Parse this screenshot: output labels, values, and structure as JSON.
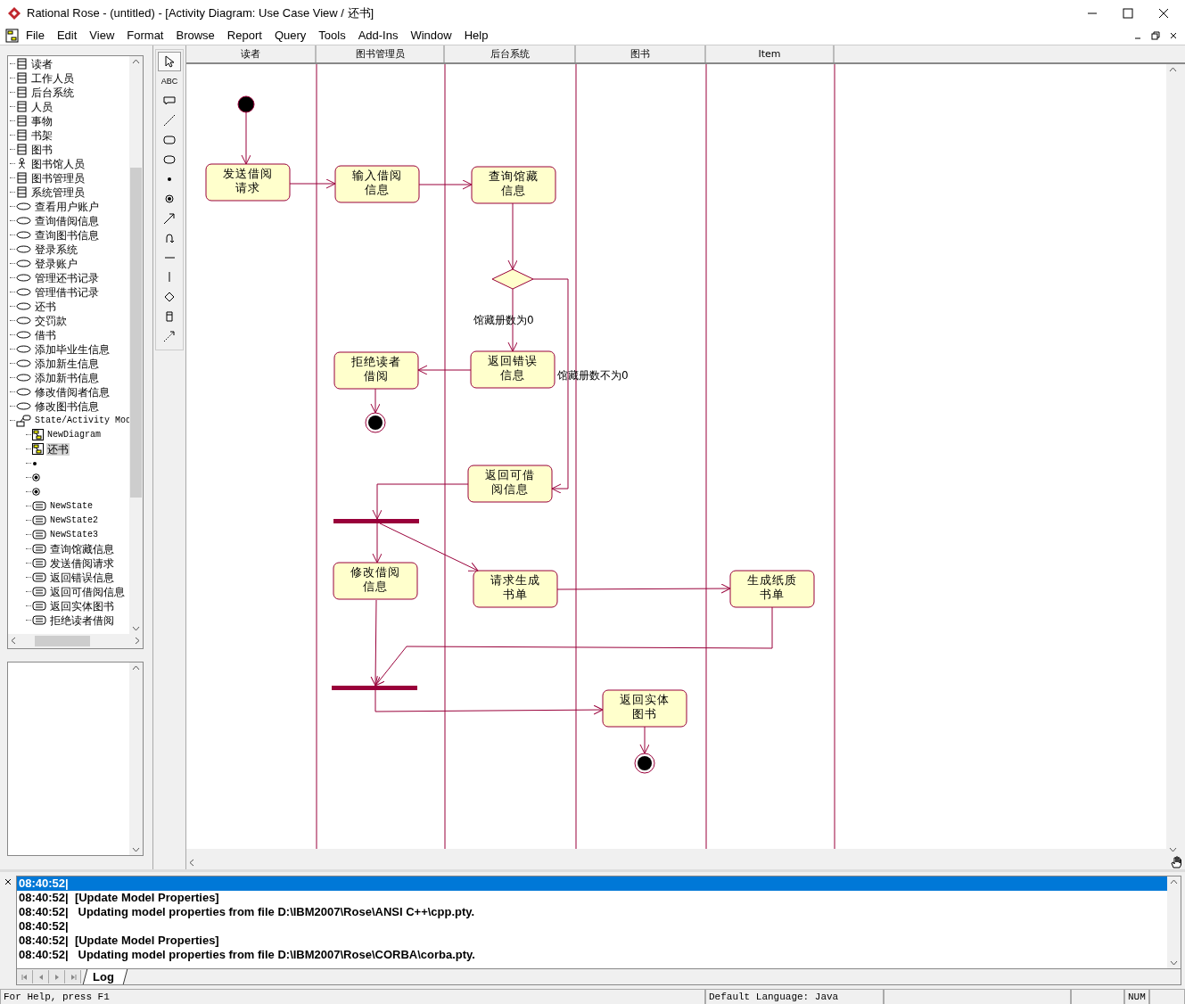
{
  "window": {
    "title": "Rational Rose - (untitled) - [Activity Diagram: Use Case View / 还书]"
  },
  "menu": [
    "File",
    "Edit",
    "View",
    "Format",
    "Browse",
    "Report",
    "Query",
    "Tools",
    "Add-Ins",
    "Window",
    "Help"
  ],
  "browser": {
    "items": [
      {
        "label": "读者",
        "kind": "class",
        "selected": false
      },
      {
        "label": "工作人员",
        "kind": "class",
        "selected": false
      },
      {
        "label": "后台系统",
        "kind": "class",
        "selected": false
      },
      {
        "label": "人员",
        "kind": "class",
        "selected": false
      },
      {
        "label": "事物",
        "kind": "class",
        "selected": false
      },
      {
        "label": "书架",
        "kind": "class",
        "selected": false
      },
      {
        "label": "图书",
        "kind": "class",
        "selected": false
      },
      {
        "label": "图书馆人员",
        "kind": "actor",
        "selected": false
      },
      {
        "label": "图书管理员",
        "kind": "class",
        "selected": false
      },
      {
        "label": "系统管理员",
        "kind": "class",
        "selected": false
      },
      {
        "label": "查看用户账户",
        "kind": "usecase",
        "selected": false
      },
      {
        "label": "查询借阅信息",
        "kind": "usecase",
        "selected": false
      },
      {
        "label": "查询图书信息",
        "kind": "usecase",
        "selected": false
      },
      {
        "label": "登录系统",
        "kind": "usecase",
        "selected": false
      },
      {
        "label": "登录账户",
        "kind": "usecase",
        "selected": false
      },
      {
        "label": "管理还书记录",
        "kind": "usecase",
        "selected": false
      },
      {
        "label": "管理借书记录",
        "kind": "usecase",
        "selected": false
      },
      {
        "label": "还书",
        "kind": "usecase",
        "selected": false
      },
      {
        "label": "交罚款",
        "kind": "usecase",
        "selected": false
      },
      {
        "label": "借书",
        "kind": "usecase",
        "selected": false
      },
      {
        "label": "添加毕业生信息",
        "kind": "usecase",
        "selected": false
      },
      {
        "label": "添加新生信息",
        "kind": "usecase",
        "selected": false
      },
      {
        "label": "添加新书信息",
        "kind": "usecase",
        "selected": false
      },
      {
        "label": "修改借阅者信息",
        "kind": "usecase",
        "selected": false
      },
      {
        "label": "修改图书信息",
        "kind": "usecase",
        "selected": false
      },
      {
        "label": "State/Activity Mod",
        "kind": "package",
        "selected": false,
        "children": [
          {
            "label": "NewDiagram",
            "kind": "diagram",
            "selected": false
          },
          {
            "label": "还书",
            "kind": "diagram",
            "selected": true
          },
          {
            "kind": "start",
            "selected": false
          },
          {
            "kind": "end",
            "selected": false
          },
          {
            "kind": "end",
            "selected": false
          },
          {
            "label": "NewState",
            "kind": "state",
            "selected": false
          },
          {
            "label": "NewState2",
            "kind": "state",
            "selected": false
          },
          {
            "label": "NewState3",
            "kind": "state",
            "selected": false
          },
          {
            "label": "查询馆藏信息",
            "kind": "state",
            "selected": false
          },
          {
            "label": "发送借阅请求",
            "kind": "state",
            "selected": false
          },
          {
            "label": "返回错误信息",
            "kind": "state",
            "selected": false
          },
          {
            "label": "返回可借阅信息",
            "kind": "state",
            "selected": false
          },
          {
            "label": "返回实体图书",
            "kind": "state",
            "selected": false
          },
          {
            "label": "拒绝读者借阅",
            "kind": "state",
            "selected": false
          }
        ]
      }
    ]
  },
  "toolbox": [
    {
      "kind": "pointer",
      "selected": true
    },
    {
      "kind": "text",
      "label": "ABC",
      "selected": false
    },
    {
      "kind": "note",
      "selected": false
    },
    {
      "kind": "anchor",
      "selected": false
    },
    {
      "kind": "state",
      "selected": false
    },
    {
      "kind": "activity",
      "selected": false
    },
    {
      "kind": "start",
      "selected": false
    },
    {
      "kind": "end",
      "selected": false
    },
    {
      "kind": "transition",
      "selected": false
    },
    {
      "kind": "loop",
      "selected": false
    },
    {
      "kind": "hsync",
      "selected": false
    },
    {
      "kind": "vsync",
      "selected": false
    },
    {
      "kind": "decision",
      "selected": false
    },
    {
      "kind": "swimlane",
      "selected": false
    },
    {
      "kind": "flow",
      "selected": false
    }
  ],
  "diagram": {
    "swimlanes": [
      "读者",
      "图书管理员",
      "后台系统",
      "图书",
      "Item"
    ],
    "activities": [
      {
        "lines": [
          "发送借阅",
          "请求"
        ]
      },
      {
        "lines": [
          "输入借阅",
          "信息"
        ]
      },
      {
        "lines": [
          "查询馆藏",
          "信息"
        ]
      },
      {
        "lines": [
          "拒绝读者",
          "借阅"
        ]
      },
      {
        "lines": [
          "返回错误",
          "信息"
        ]
      },
      {
        "lines": [
          "返回可借",
          "阅信息"
        ]
      },
      {
        "lines": [
          "修改借阅",
          "信息"
        ]
      },
      {
        "lines": [
          "请求生成",
          "书单"
        ]
      },
      {
        "lines": [
          "生成纸质",
          "书单"
        ]
      },
      {
        "lines": [
          "返回实体",
          "图书"
        ]
      }
    ],
    "guards": [
      "馆藏册数为0",
      "馆藏册数不为0"
    ]
  },
  "log": {
    "lines": [
      {
        "text": "08:40:52|",
        "selected": true
      },
      {
        "text": "08:40:52|  [Update Model Properties]",
        "selected": false
      },
      {
        "text": "08:40:52|   Updating model properties from file D:\\IBM2007\\Rose\\ANSI C++\\cpp.pty.",
        "selected": false
      },
      {
        "text": "08:40:52|",
        "selected": false
      },
      {
        "text": "08:40:52|  [Update Model Properties]",
        "selected": false
      },
      {
        "text": "08:40:52|   Updating model properties from file D:\\IBM2007\\Rose\\CORBA\\corba.pty.",
        "selected": false
      }
    ],
    "tab": "Log"
  },
  "status_bar": {
    "help": "For Help, press F1",
    "language": "Default Language: Java",
    "num": "NUM"
  }
}
